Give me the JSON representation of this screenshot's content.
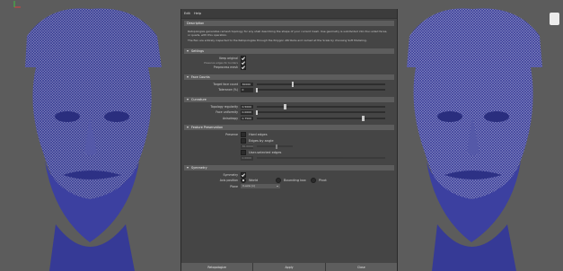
{
  "menu": {
    "edit": "Edit",
    "help": "Help"
  },
  "description": {
    "header": "Description",
    "text1": "Retopologize generates remesh topology for any shell describing the shape of your current mesh. Use geometry is subdivided into four-sided faces, or quads, with this operation.",
    "text2": "The flex are entirely inspected to the Retopologize through the Polygon Attribute and named at the Scale by choosing Soft Modeling."
  },
  "settings": {
    "header": "Settings",
    "keep_original_label": "Keep original",
    "keep_original_sub": "Preserve edges for borders",
    "preprocess_label": "Preprocess mesh"
  },
  "face_count": {
    "header": "Face Counts",
    "target_face_label": "Target face count",
    "target_face_value": "30000",
    "tolerance_label": "Tolerance (%)",
    "tolerance_value": "0"
  },
  "curvature": {
    "header": "Curvature",
    "topology_label": "Topology regularity",
    "topology_value": "0.5000",
    "face_uniformity_label": "Face uniformity",
    "face_uniformity_value": "0.0000",
    "anisotropy_label": "Anisotropy",
    "anisotropy_value": "0.7500"
  },
  "feature_preservation": {
    "header": "Feature Preservation",
    "preserve_label": "Preserve",
    "hard_edges": "Hard edges",
    "edges_by_angle": "Edges by angle",
    "angle_value": "30.0000",
    "user_edges": "User-selected edges",
    "extra_field": "0.0000"
  },
  "symmetry": {
    "header": "Symmetry",
    "symmetry_label": "Symmetry",
    "axis_position_label": "Axis position",
    "opt_world": "World",
    "opt_bounding_box": "Bounding box",
    "opt_pivot": "Pivot",
    "plane_label": "Plane",
    "plane_value": "X-axis (x)"
  },
  "buttons": {
    "apply_close": "Retopologize",
    "apply": "Apply",
    "close": "Close"
  },
  "values": {
    "target_face_fraction": 0.28,
    "tolerance_fraction": 0.0,
    "topology_fraction": 0.22,
    "face_uniformity_fraction": 0.0,
    "anisotropy_fraction": 0.83,
    "angle_fraction": 0.55
  },
  "colors": {
    "mesh": "#3a3e9c",
    "panel": "#454545",
    "header": "#5d5d5d"
  }
}
